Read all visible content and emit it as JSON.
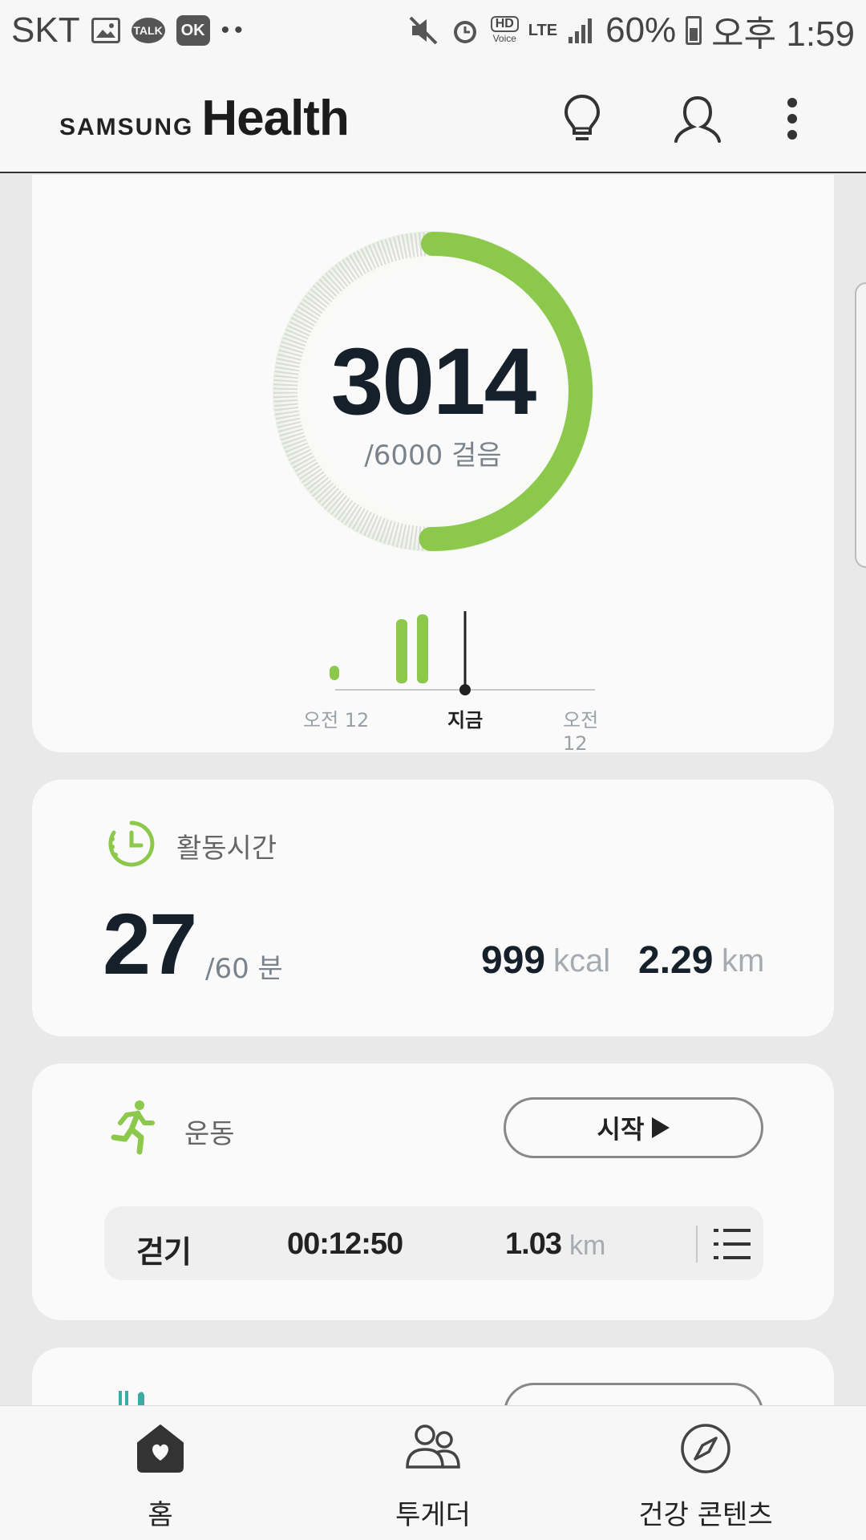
{
  "status_bar": {
    "carrier": "SKT",
    "talk_badge": "TALK",
    "ok_badge": "OK",
    "hd_label": "HD",
    "voice_label": "Voice",
    "network": "LTE",
    "battery": "60%",
    "time": "오후 1:59"
  },
  "app_bar": {
    "brand_samsung": "SAMSUNG",
    "brand_health": "Health"
  },
  "steps": {
    "value": "3014",
    "goal_text": "/6000 걸음",
    "progress": 0.502,
    "histogram": {
      "start_label": "오전 12",
      "now_label": "지금",
      "end_label": "오전 12"
    },
    "accent_color": "#8cc84b"
  },
  "active_time": {
    "title": "활동시간",
    "value": "27",
    "goal_text": "/60 분",
    "kcal_value": "999",
    "kcal_unit": "kcal",
    "distance_value": "2.29",
    "distance_unit": "km"
  },
  "exercise": {
    "title": "운동",
    "start_label": "시작",
    "record": {
      "type": "걷기",
      "duration": "00:12:50",
      "distance_value": "1.03",
      "distance_unit": "km"
    }
  },
  "bottom_nav": {
    "items": [
      {
        "label": "홈",
        "icon": "home-heart-icon",
        "active": true
      },
      {
        "label": "투게더",
        "icon": "people-icon",
        "active": false
      },
      {
        "label": "건강 콘텐츠",
        "icon": "compass-icon",
        "active": false
      }
    ]
  }
}
